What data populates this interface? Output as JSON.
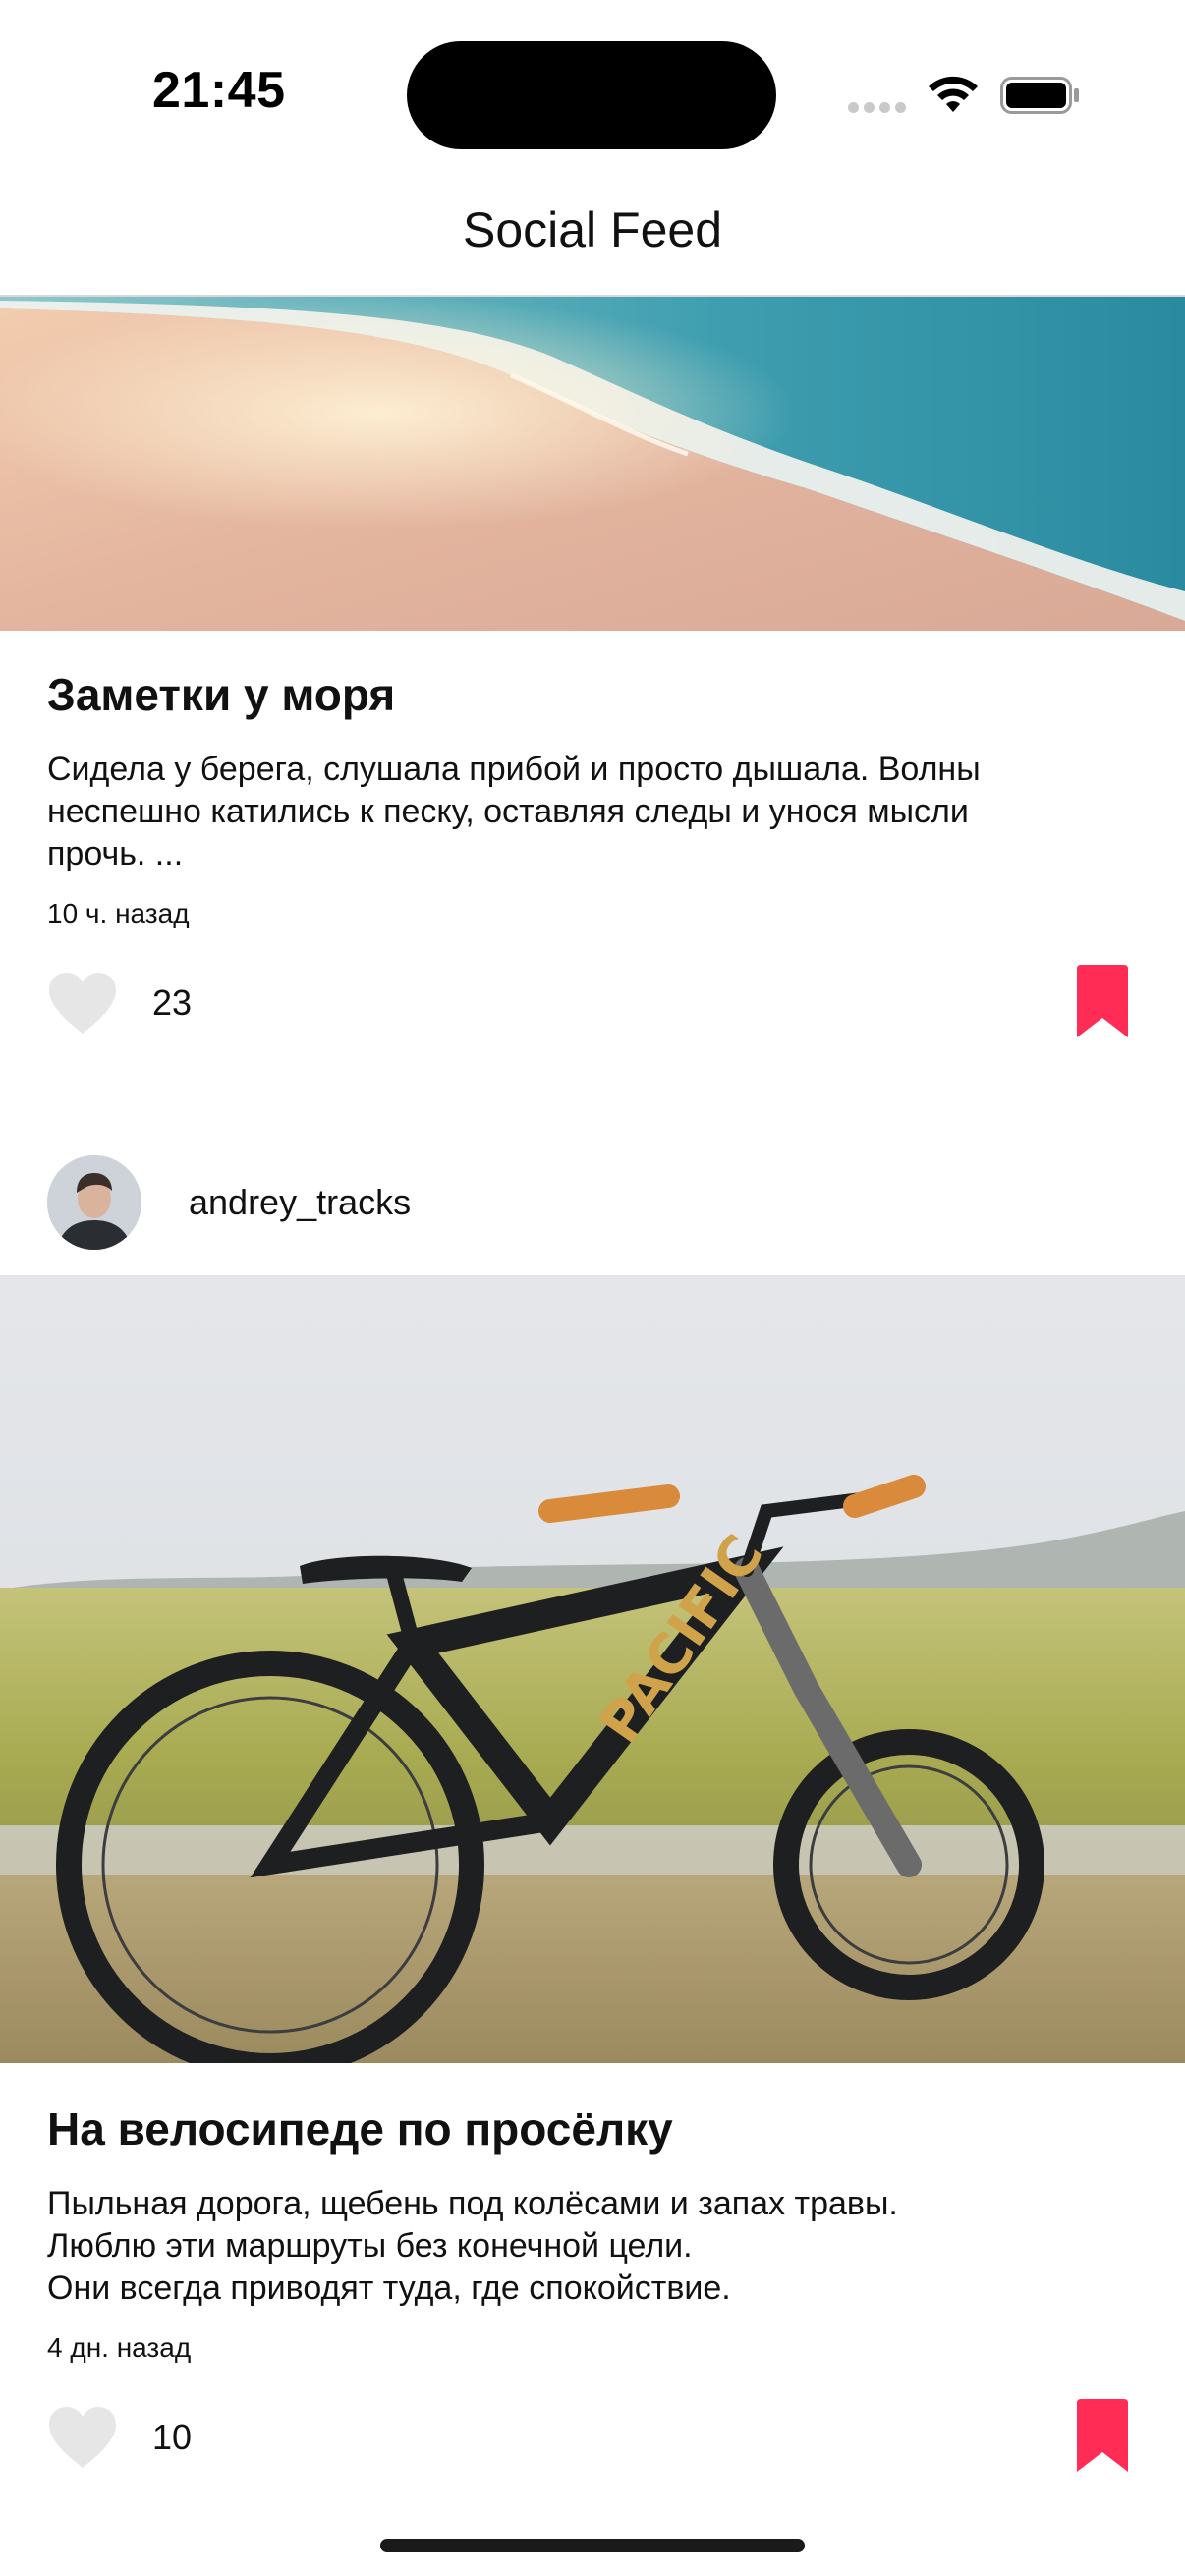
{
  "status_bar": {
    "time": "21:45"
  },
  "nav": {
    "title": "Social Feed"
  },
  "posts": [
    {
      "title": "Заметки у моря",
      "body": "Сидела у берега, слушала прибой и просто дышала. Волны\nнеспешно катились к песку, оставляя следы и унося мысли\nпрочь. ...",
      "time": "10 ч. назад",
      "likes": "23",
      "bookmarked": true
    },
    {
      "author": "andrey_tracks",
      "title": "На велосипеде по просёлку",
      "body": "Пыльная дорога, щебень под колёсами и запах травы.\nЛюблю эти маршруты без конечной цели.\nОни всегда приводят туда, где спокойствие.",
      "time": "4 дн. назад",
      "likes": "10",
      "bookmarked": true
    }
  ],
  "colors": {
    "accent": "#ff2d55",
    "like_inactive": "#e6e6e6"
  }
}
